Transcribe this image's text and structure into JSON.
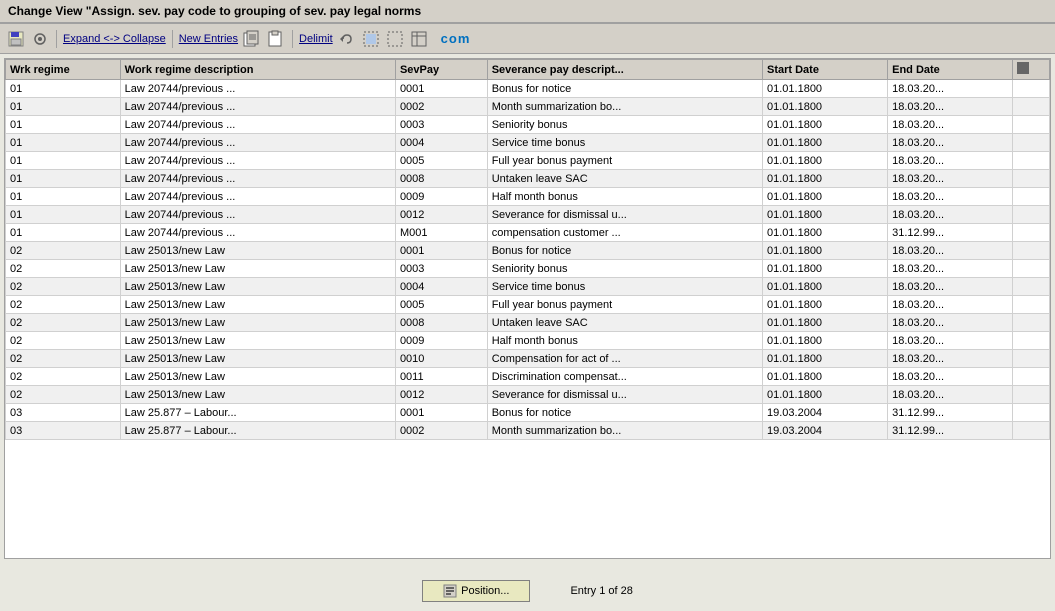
{
  "title": "Change View \"Assign. sev. pay code to grouping of sev. pay legal norms",
  "toolbar": {
    "expand_collapse_label": "Expand <-> Collapse",
    "new_entries_label": "New Entries",
    "delimit_label": "Delimit"
  },
  "table": {
    "columns": [
      {
        "id": "wrk",
        "label": "Wrk regime"
      },
      {
        "id": "desc",
        "label": "Work regime description"
      },
      {
        "id": "sevpay",
        "label": "SevPay"
      },
      {
        "id": "sevdesc",
        "label": "Severance pay descript..."
      },
      {
        "id": "start",
        "label": "Start Date"
      },
      {
        "id": "end",
        "label": "End Date"
      },
      {
        "id": "icon",
        "label": ""
      }
    ],
    "rows": [
      {
        "wrk": "01",
        "desc": "Law 20744/previous ...",
        "sevpay": "0001",
        "sevdesc": "Bonus for notice",
        "start": "01.01.1800",
        "end": "18.03.20..."
      },
      {
        "wrk": "01",
        "desc": "Law 20744/previous ...",
        "sevpay": "0002",
        "sevdesc": "Month summarization bo...",
        "start": "01.01.1800",
        "end": "18.03.20..."
      },
      {
        "wrk": "01",
        "desc": "Law 20744/previous ...",
        "sevpay": "0003",
        "sevdesc": "Seniority bonus",
        "start": "01.01.1800",
        "end": "18.03.20..."
      },
      {
        "wrk": "01",
        "desc": "Law 20744/previous ...",
        "sevpay": "0004",
        "sevdesc": "Service time bonus",
        "start": "01.01.1800",
        "end": "18.03.20..."
      },
      {
        "wrk": "01",
        "desc": "Law 20744/previous ...",
        "sevpay": "0005",
        "sevdesc": "Full year  bonus payment",
        "start": "01.01.1800",
        "end": "18.03.20..."
      },
      {
        "wrk": "01",
        "desc": "Law 20744/previous ...",
        "sevpay": "0008",
        "sevdesc": "Untaken leave SAC",
        "start": "01.01.1800",
        "end": "18.03.20..."
      },
      {
        "wrk": "01",
        "desc": "Law 20744/previous ...",
        "sevpay": "0009",
        "sevdesc": "Half month bonus",
        "start": "01.01.1800",
        "end": "18.03.20..."
      },
      {
        "wrk": "01",
        "desc": "Law 20744/previous ...",
        "sevpay": "0012",
        "sevdesc": "Severance for dismissal u...",
        "start": "01.01.1800",
        "end": "18.03.20..."
      },
      {
        "wrk": "01",
        "desc": "Law 20744/previous ...",
        "sevpay": "M001",
        "sevdesc": "compensation customer ...",
        "start": "01.01.1800",
        "end": "31.12.99..."
      },
      {
        "wrk": "02",
        "desc": "Law 25013/new Law",
        "sevpay": "0001",
        "sevdesc": "Bonus for notice",
        "start": "01.01.1800",
        "end": "18.03.20..."
      },
      {
        "wrk": "02",
        "desc": "Law 25013/new Law",
        "sevpay": "0003",
        "sevdesc": "Seniority bonus",
        "start": "01.01.1800",
        "end": "18.03.20..."
      },
      {
        "wrk": "02",
        "desc": "Law 25013/new Law",
        "sevpay": "0004",
        "sevdesc": "Service time bonus",
        "start": "01.01.1800",
        "end": "18.03.20..."
      },
      {
        "wrk": "02",
        "desc": "Law 25013/new Law",
        "sevpay": "0005",
        "sevdesc": "Full year  bonus payment",
        "start": "01.01.1800",
        "end": "18.03.20..."
      },
      {
        "wrk": "02",
        "desc": "Law 25013/new Law",
        "sevpay": "0008",
        "sevdesc": "Untaken leave SAC",
        "start": "01.01.1800",
        "end": "18.03.20..."
      },
      {
        "wrk": "02",
        "desc": "Law 25013/new Law",
        "sevpay": "0009",
        "sevdesc": "Half month bonus",
        "start": "01.01.1800",
        "end": "18.03.20..."
      },
      {
        "wrk": "02",
        "desc": "Law 25013/new Law",
        "sevpay": "0010",
        "sevdesc": "Compensation for act of ...",
        "start": "01.01.1800",
        "end": "18.03.20..."
      },
      {
        "wrk": "02",
        "desc": "Law 25013/new Law",
        "sevpay": "0011",
        "sevdesc": "Discrimination compensat...",
        "start": "01.01.1800",
        "end": "18.03.20..."
      },
      {
        "wrk": "02",
        "desc": "Law 25013/new Law",
        "sevpay": "0012",
        "sevdesc": "Severance for dismissal u...",
        "start": "01.01.1800",
        "end": "18.03.20..."
      },
      {
        "wrk": "03",
        "desc": "Law 25.877 – Labour...",
        "sevpay": "0001",
        "sevdesc": "Bonus for notice",
        "start": "19.03.2004",
        "end": "31.12.99..."
      },
      {
        "wrk": "03",
        "desc": "Law 25.877 – Labour...",
        "sevpay": "0002",
        "sevdesc": "Month summarization bo...",
        "start": "19.03.2004",
        "end": "31.12.99..."
      }
    ]
  },
  "bottom": {
    "position_label": "Position...",
    "entry_info": "Entry 1 of 28"
  }
}
